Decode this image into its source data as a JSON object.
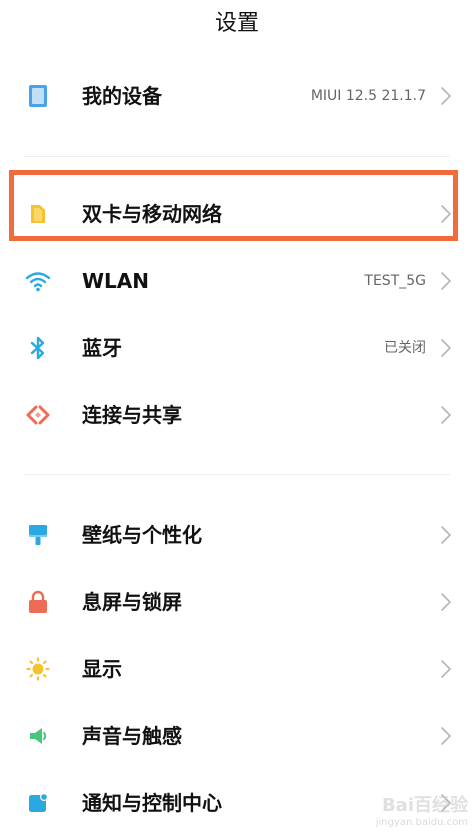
{
  "header": {
    "title": "设置"
  },
  "sections": [
    {
      "items": [
        {
          "label": "我的设备",
          "value": "MIUI 12.5 21.1.7",
          "icon": "phone-device-icon",
          "color": "#4aa3e8"
        }
      ]
    },
    {
      "items": [
        {
          "label": "双卡与移动网络",
          "value": "",
          "icon": "sim-card-icon",
          "color": "#f5c330",
          "highlighted": true
        },
        {
          "label": "WLAN",
          "value": "TEST_5G",
          "icon": "wifi-icon",
          "color": "#2aa8e0"
        },
        {
          "label": "蓝牙",
          "value": "已关闭",
          "icon": "bluetooth-icon",
          "color": "#2aa8e0"
        },
        {
          "label": "连接与共享",
          "value": "",
          "icon": "connection-share-icon",
          "color": "#ee6b55"
        }
      ]
    },
    {
      "items": [
        {
          "label": "壁纸与个性化",
          "value": "",
          "icon": "wallpaper-brush-icon",
          "color": "#2aa8e0"
        },
        {
          "label": "息屏与锁屏",
          "value": "",
          "icon": "lock-icon",
          "color": "#ee6b55"
        },
        {
          "label": "显示",
          "value": "",
          "icon": "sun-display-icon",
          "color": "#f5c330"
        },
        {
          "label": "声音与触感",
          "value": "",
          "icon": "speaker-icon",
          "color": "#46c77a"
        },
        {
          "label": "通知与控制中心",
          "value": "",
          "icon": "notification-icon",
          "color": "#2aa8e0"
        }
      ]
    }
  ],
  "highlight_color": "#f26b3a",
  "watermark": {
    "text": "Bai百经验",
    "sub": "jingyan.baidu.com"
  }
}
